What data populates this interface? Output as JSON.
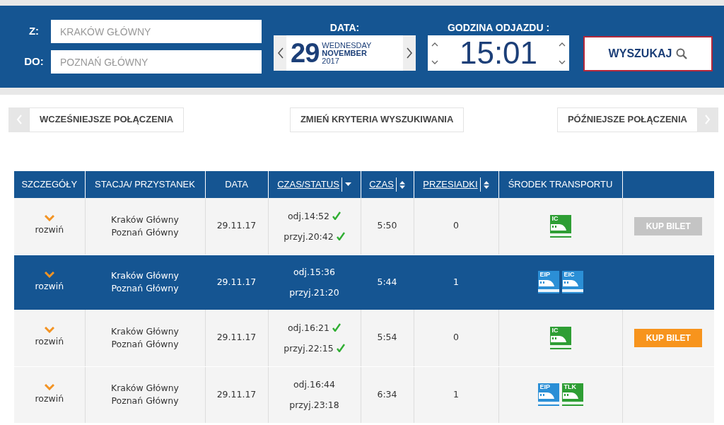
{
  "search": {
    "from": {
      "label": "Z:",
      "placeholder": "KRAKÓW GŁÓWNY"
    },
    "to": {
      "label": "DO:",
      "placeholder": "POZNAŃ GŁÓWNY"
    },
    "date": {
      "label": "DATA:",
      "day": "29",
      "weekday": "WEDNESDAY",
      "month": "NOVEMBER",
      "year": "2017"
    },
    "time": {
      "label": "GODZINA ODJAZDU :",
      "value": "15:01"
    },
    "button": "WYSZUKAJ"
  },
  "navigation": {
    "earlier": "WCZEŚNIEJSZE POŁĄCZENIA",
    "change": "ZMIEŃ KRYTERIA WYSZUKIWANIA",
    "later": "PÓŹNIEJSZE POŁĄCZENIA"
  },
  "table": {
    "columns": [
      {
        "label": "SZCZEGÓŁY"
      },
      {
        "label": "STACJA/ PRZYSTANEK"
      },
      {
        "label": "DATA"
      },
      {
        "label": "CZAS/STATUS",
        "sortable": true,
        "sorted": true
      },
      {
        "label": "CZAS",
        "sortable": true,
        "sorted": false
      },
      {
        "label": "PRZESIADKI",
        "sortable": true,
        "sorted": false
      },
      {
        "label": "ŚRODEK TRANSPORTU"
      }
    ],
    "rows": [
      {
        "selected": false,
        "expand": "rozwiń",
        "stations": [
          "Kraków Główny",
          "Poznań Główny"
        ],
        "date": "29.11.17",
        "departure": {
          "text": "odj.14:52",
          "confirmed": true
        },
        "arrival": {
          "text": "przyj.20:42",
          "confirmed": true
        },
        "duration": "5:50",
        "changes": "0",
        "trains": [
          {
            "label": "IC",
            "color": "#2e9e34"
          }
        ],
        "buy": {
          "label": "KUP BILET",
          "disabled": true
        }
      },
      {
        "selected": true,
        "expand": "rozwiń",
        "stations": [
          "Kraków Główny",
          "Poznań Główny"
        ],
        "date": "29.11.17",
        "departure": {
          "text": "odj.15:36",
          "confirmed": false
        },
        "arrival": {
          "text": "przyj.21:20",
          "confirmed": false
        },
        "duration": "5:44",
        "changes": "1",
        "trains": [
          {
            "label": "EIP",
            "color": "#2b8fd6"
          },
          {
            "label": "EIC",
            "color": "#2b8fd6"
          }
        ]
      },
      {
        "selected": false,
        "expand": "rozwiń",
        "stations": [
          "Kraków Główny",
          "Poznań Główny"
        ],
        "date": "29.11.17",
        "departure": {
          "text": "odj.16:21",
          "confirmed": true
        },
        "arrival": {
          "text": "przyj.22:15",
          "confirmed": true
        },
        "duration": "5:54",
        "changes": "0",
        "trains": [
          {
            "label": "IC",
            "color": "#2e9e34"
          }
        ],
        "buy": {
          "label": "KUP BILET",
          "disabled": false
        }
      },
      {
        "selected": false,
        "expand": "rozwiń",
        "stations": [
          "Kraków Główny",
          "Poznań Główny"
        ],
        "date": "29.11.17",
        "departure": {
          "text": "odj.16:44",
          "confirmed": false
        },
        "arrival": {
          "text": "przyj.23:18",
          "confirmed": false
        },
        "duration": "6:34",
        "changes": "1",
        "trains": [
          {
            "label": "EIP",
            "color": "#2b8fd6"
          },
          {
            "label": "TLK",
            "color": "#2e9e34"
          }
        ]
      }
    ]
  }
}
